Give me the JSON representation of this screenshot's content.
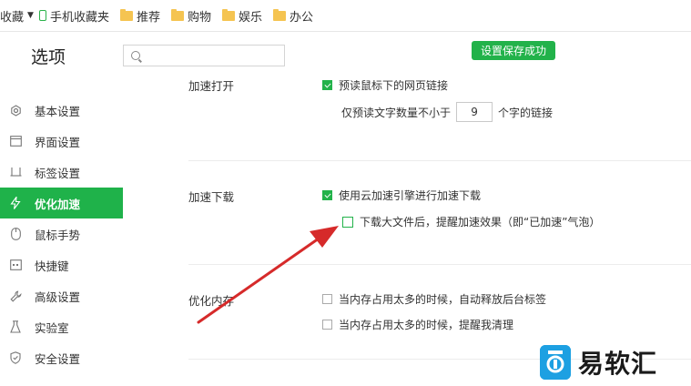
{
  "bookmarks": {
    "items": [
      {
        "label": "收藏",
        "type": "text"
      },
      {
        "label": "手机收藏夹",
        "type": "phone"
      },
      {
        "label": "推荐",
        "type": "folder"
      },
      {
        "label": "购物",
        "type": "folder"
      },
      {
        "label": "娱乐",
        "type": "folder"
      },
      {
        "label": "办公",
        "type": "folder"
      }
    ]
  },
  "header": {
    "title": "选项",
    "search_placeholder": "",
    "save_status": "设置保存成功"
  },
  "sidebar": {
    "items": [
      {
        "label": "基本设置",
        "icon": "gear-icon"
      },
      {
        "label": "界面设置",
        "icon": "window-icon"
      },
      {
        "label": "标签设置",
        "icon": "tab-icon"
      },
      {
        "label": "优化加速",
        "icon": "bolt-icon",
        "active": true
      },
      {
        "label": "鼠标手势",
        "icon": "mouse-icon"
      },
      {
        "label": "快捷键",
        "icon": "keyboard-icon"
      },
      {
        "label": "高级设置",
        "icon": "wrench-icon"
      },
      {
        "label": "实验室",
        "icon": "flask-icon"
      },
      {
        "label": "安全设置",
        "icon": "shield-icon"
      }
    ]
  },
  "main": {
    "accelerate_open": {
      "label": "加速打开",
      "preload_option": "预读鼠标下的网页链接",
      "preload_prefix": "仅预读文字数量不小于",
      "preload_value": "9",
      "preload_suffix": "个字的链接"
    },
    "accelerate_download": {
      "label": "加速下载",
      "option1": "使用云加速引擎进行加速下载",
      "option2": "下载大文件后，提醒加速效果（即“已加速”气泡）"
    },
    "optimize_memory": {
      "label": "优化内存",
      "option1": "当内存占用太多的时候，自动释放后台标签",
      "option2": "当内存占用太多的时候，提醒我清理"
    }
  },
  "watermark": {
    "text": "易软汇"
  },
  "colors": {
    "accent": "#1fb24a",
    "arrow": "#d62a2a",
    "watermark_blue": "#1da0e2"
  }
}
